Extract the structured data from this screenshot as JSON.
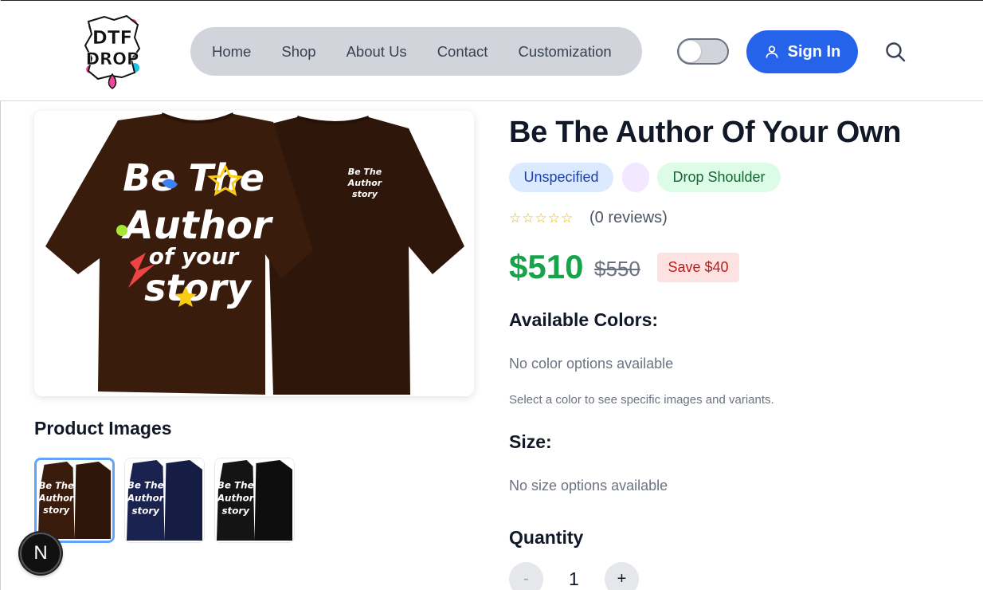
{
  "header": {
    "logo_text": "DTF DROP",
    "nav": [
      "Home",
      "Shop",
      "About Us",
      "Contact",
      "Customization"
    ],
    "theme_toggle_on": false,
    "signin_label": "Sign In"
  },
  "product": {
    "title": "Be The Author Of Your Own",
    "badges": [
      "Unspecified",
      "",
      "Drop Shoulder"
    ],
    "stars": "☆☆☆☆☆",
    "reviews": "(0 reviews)",
    "price": "$510",
    "old_price": "$550",
    "save": "Save $40",
    "print_text": [
      "Be The",
      "Author",
      "of your",
      "story"
    ],
    "colors_heading": "Available Colors:",
    "colors_empty": "No color options available",
    "colors_hint": "Select a color to see specific images and variants.",
    "size_heading": "Size:",
    "size_empty": "No size options available",
    "quantity_heading": "Quantity",
    "quantity_value": "1",
    "qty_minus": "-",
    "qty_plus": "+"
  },
  "gallery": {
    "title": "Product Images",
    "thumbs": [
      {
        "shirt": "#3a1c0c",
        "selected": true
      },
      {
        "shirt": "#1a2350",
        "selected": false
      },
      {
        "shirt": "#141414",
        "selected": false
      }
    ],
    "main_shirt_color": "#3a1c0c"
  },
  "dev_badge": "N"
}
